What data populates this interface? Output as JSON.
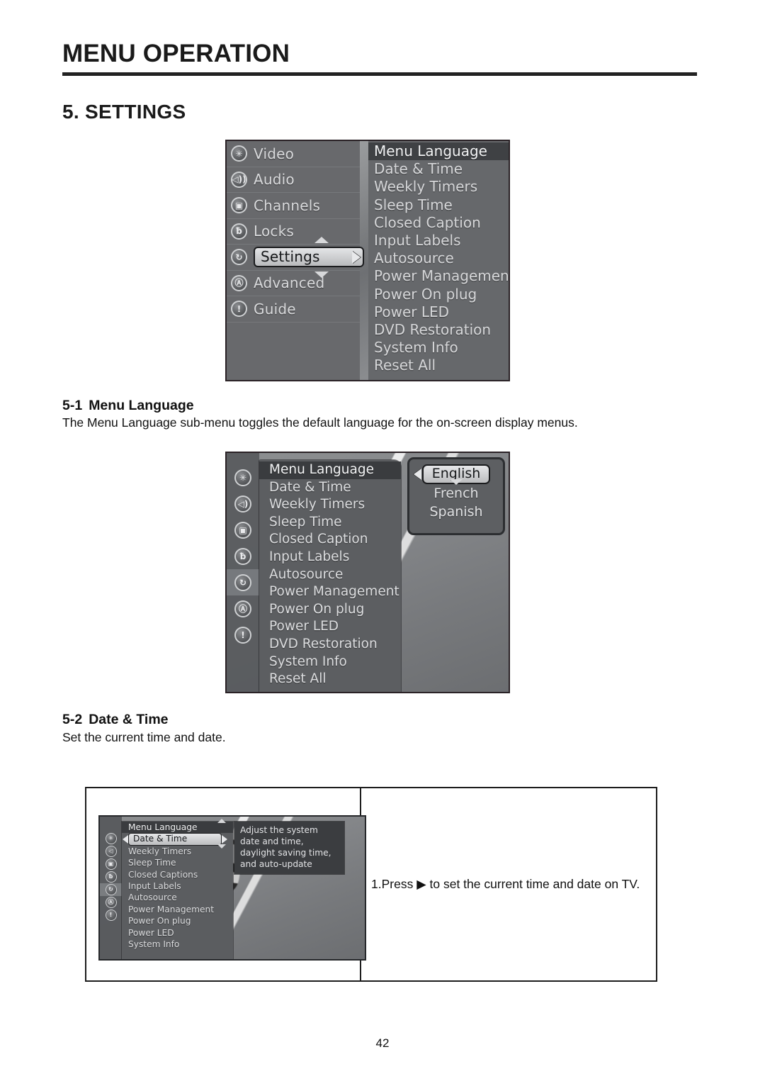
{
  "header": {
    "title": "MENU OPERATION"
  },
  "section": {
    "title": "5. SETTINGS"
  },
  "subsections": [
    {
      "num": "5-1",
      "title": "Menu Language",
      "body": "The Menu Language sub-menu toggles the default language for the on-screen display menus."
    },
    {
      "num": "5-2",
      "title": "Date & Time",
      "body": "Set the current time and date."
    }
  ],
  "osd_main": {
    "left_menu": [
      {
        "label": "Video",
        "icon": "starburst-icon",
        "glyph": "✳",
        "selected": false
      },
      {
        "label": "Audio",
        "icon": "speaker-icon",
        "glyph": "◂))",
        "selected": false
      },
      {
        "label": "Channels",
        "icon": "television-icon",
        "glyph": "▣",
        "selected": false
      },
      {
        "label": "Locks",
        "icon": "padlock-icon",
        "glyph": "ƀ",
        "selected": false
      },
      {
        "label": "Settings",
        "icon": "settings-icon",
        "glyph": "↻",
        "selected": true
      },
      {
        "label": "Advanced",
        "icon": "advanced-a-icon",
        "glyph": "Ⓐ",
        "selected": false
      },
      {
        "label": "Guide",
        "icon": "info-icon",
        "glyph": "!",
        "selected": false
      }
    ],
    "right_menu": [
      "Menu Language",
      "Date & Time",
      "Weekly Timers",
      "Sleep Time",
      "Closed Caption",
      "Input Labels",
      "Autosource",
      "Power Management",
      "Power On plug",
      "Power LED",
      "DVD Restoration",
      "System Info",
      "Reset All"
    ]
  },
  "osd_language": {
    "rail_icons": [
      {
        "icon": "starburst-icon",
        "glyph": "✳",
        "active": false
      },
      {
        "icon": "speaker-icon",
        "glyph": "◂))",
        "active": false
      },
      {
        "icon": "television-icon",
        "glyph": "▣",
        "active": false
      },
      {
        "icon": "padlock-icon",
        "glyph": "ƀ",
        "active": false
      },
      {
        "icon": "settings-icon",
        "glyph": "↻",
        "active": true
      },
      {
        "icon": "advanced-a-icon",
        "glyph": "Ⓐ",
        "active": false
      },
      {
        "icon": "info-icon",
        "glyph": "!",
        "active": false
      }
    ],
    "items": [
      "Menu Language",
      "Date & Time",
      "Weekly Timers",
      "Sleep Time",
      "Closed Caption",
      "Input Labels",
      "Autosource",
      "Power Management",
      "Power On plug",
      "Power LED",
      "DVD Restoration",
      "System Info",
      "Reset All"
    ],
    "popup": {
      "options": [
        "English",
        "French",
        "Spanish"
      ],
      "selected": "English"
    }
  },
  "osd_datetime": {
    "rail_icons": [
      {
        "icon": "starburst-icon",
        "glyph": "✳",
        "active": false
      },
      {
        "icon": "speaker-icon",
        "glyph": "◂",
        "active": false
      },
      {
        "icon": "television-icon",
        "glyph": "▣",
        "active": false
      },
      {
        "icon": "padlock-icon",
        "glyph": "ƀ",
        "active": false
      },
      {
        "icon": "settings-icon",
        "glyph": "↻",
        "active": true
      },
      {
        "icon": "advanced-a-icon",
        "glyph": "Ⓐ",
        "active": false
      },
      {
        "icon": "info-icon",
        "glyph": "!",
        "active": false
      }
    ],
    "items": [
      "Menu Language",
      "Date & Time",
      "Weekly Timers",
      "Sleep Time",
      "Closed Captions",
      "Input Labels",
      "Autosource",
      "Power Management",
      "Power On plug",
      "Power LED",
      "System Info"
    ],
    "selected": "Date & Time",
    "tooltip_lines": [
      "Adjust the system",
      "date and time,",
      "daylight saving time,",
      "and auto-update"
    ]
  },
  "table": {
    "instruction": "1.Press ▶ to set the current time and date on TV."
  },
  "footer": {
    "page_number": "42"
  },
  "colors": {
    "rule": "#222222",
    "osd_panel": "#5c5e61",
    "osd_highlight": "#3a3c3f",
    "osd_text": "#dcdddf",
    "pill": "#e4e5e7"
  }
}
